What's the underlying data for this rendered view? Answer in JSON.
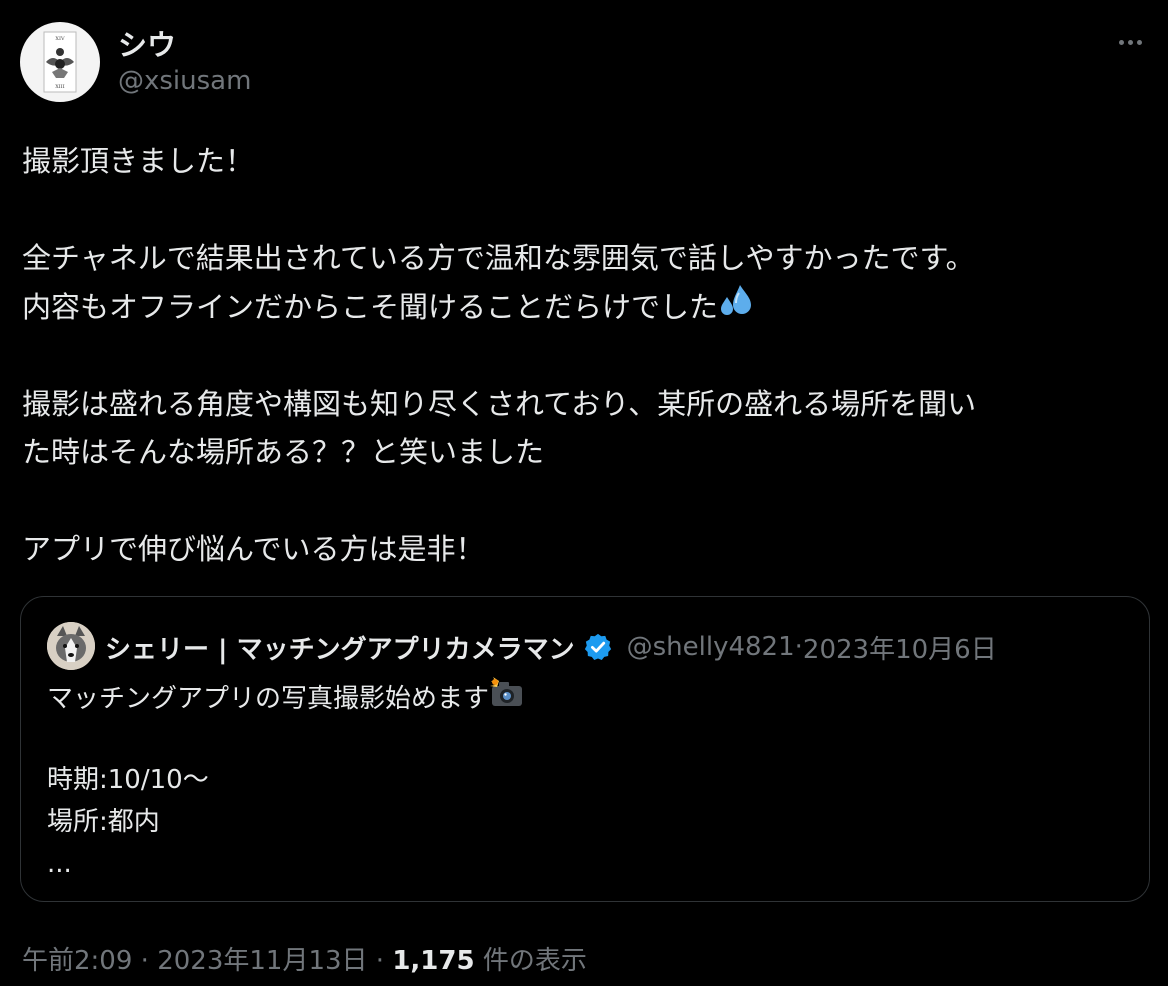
{
  "author": {
    "display_name": "シウ",
    "handle": "@xsiusam"
  },
  "tweet": {
    "lines": [
      "撮影頂きました！",
      "",
      "全チャネルで結果出されている方で温和な雰囲気で話しやすかったです。",
      "内容もオフラインだからこそ聞けることだらけでした",
      "",
      "撮影は盛れる角度や構図も知り尽くされており、某所の盛れる場所を聞い",
      "た時はそんな場所ある？？と笑いました",
      "",
      "アプリで伸び悩んでいる方は是非！"
    ],
    "line_emoji": "sweat-droplets-icon"
  },
  "quoted": {
    "display_name": "シェリー | マッチングアプリカメラマン",
    "handle": "@shelly4821",
    "separator": " · ",
    "date": "2023年10月6日",
    "lines": [
      "マッチングアプリの写真撮影始めます",
      "",
      "時期:10/10～",
      "場所:都内",
      "..."
    ],
    "line_emoji": "camera-flash-icon"
  },
  "footer": {
    "time": "午前2:09",
    "sep1": " · ",
    "date": "2023年11月13日",
    "sep2": " · ",
    "views_count": "1,175",
    "views_label": " 件の表示"
  },
  "colors": {
    "background": "#000000",
    "text": "#e7e9ea",
    "muted": "#71767b",
    "border": "#2f3336",
    "verified": "#1d9bf0",
    "sweat": "#5dadec"
  }
}
